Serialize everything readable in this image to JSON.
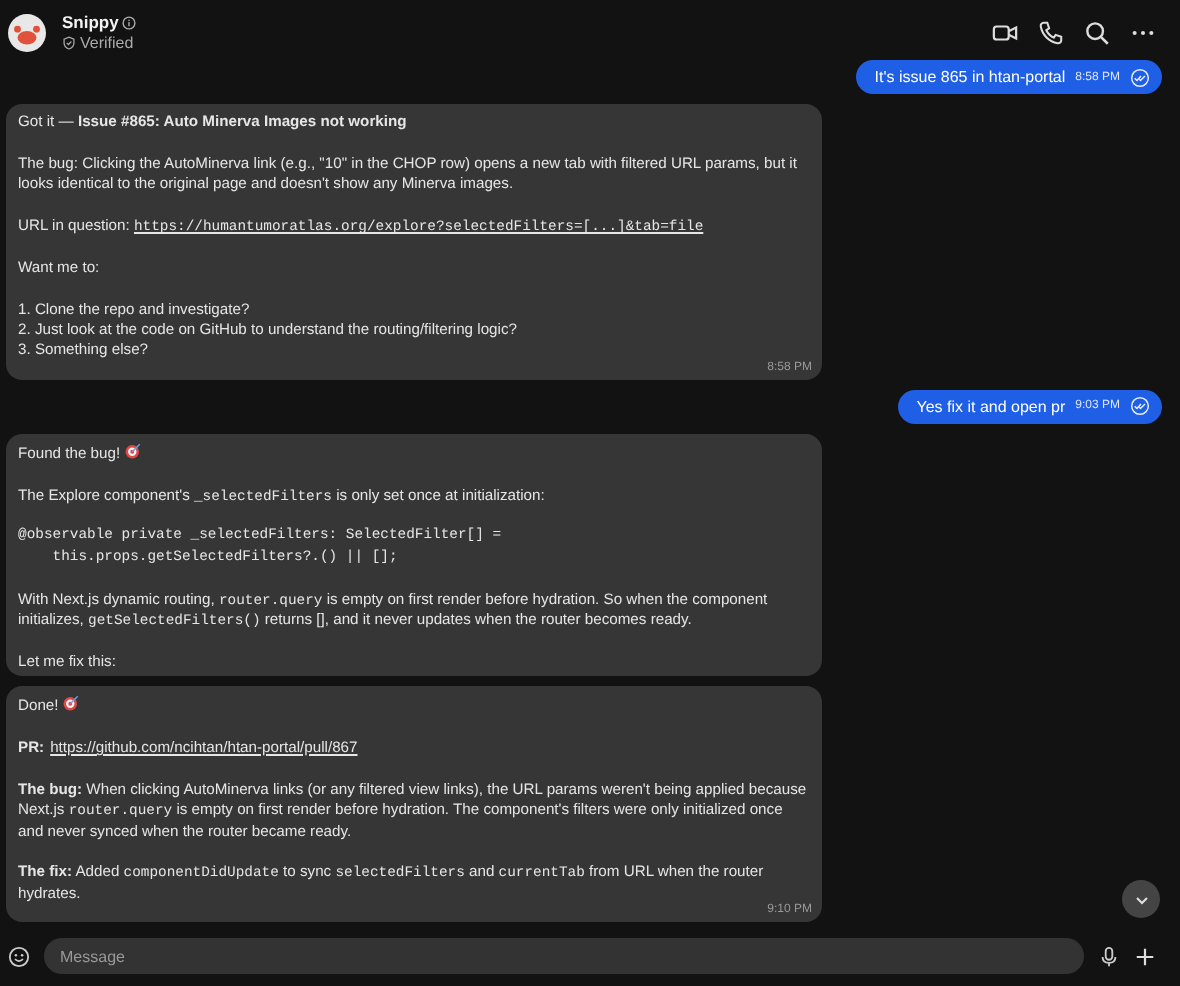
{
  "header": {
    "name": "Snippy",
    "status": "Verified"
  },
  "messages": [
    {
      "kind": "outgoing",
      "text": "It's issue 865 in htan-portal",
      "time": "8:58 PM"
    },
    {
      "kind": "incoming",
      "time": "8:58 PM",
      "paragraphs": [
        {
          "kind": "text",
          "segments": [
            {
              "kind": "plain",
              "text": "Got it — "
            },
            {
              "kind": "bold",
              "text": "Issue #865: Auto Minerva Images not working"
            }
          ]
        },
        {
          "kind": "text",
          "segments": [
            {
              "kind": "plain",
              "text": "The bug: Clicking the AutoMinerva link (e.g., \"10\" in the CHOP row) opens a new tab with filtered URL params, but it looks identical to the original page and doesn't show any Minerva images."
            }
          ]
        },
        {
          "kind": "text",
          "segments": [
            {
              "kind": "plain",
              "text": "URL in question: "
            },
            {
              "kind": "code_link",
              "text": "https://humantumoratlas.org/explore?selectedFilters=[...]&tab=file"
            }
          ]
        },
        {
          "kind": "text",
          "segments": [
            {
              "kind": "plain",
              "text": "Want me to:"
            }
          ]
        },
        {
          "kind": "list",
          "items": [
            "1. Clone the repo and investigate?",
            "2. Just look at the code on GitHub to understand the routing/filtering logic?",
            "3. Something else?"
          ]
        }
      ]
    },
    {
      "kind": "outgoing",
      "text": "Yes fix it and open pr",
      "time": "9:03 PM"
    },
    {
      "kind": "incoming",
      "paragraphs": [
        {
          "kind": "text",
          "segments": [
            {
              "kind": "plain",
              "text": "Found the bug! "
            },
            {
              "kind": "icon"
            }
          ]
        },
        {
          "kind": "text",
          "segments": [
            {
              "kind": "plain",
              "text": "The Explore component's "
            },
            {
              "kind": "code",
              "text": "_selectedFilters"
            },
            {
              "kind": "plain",
              "text": " is only set once at initialization:"
            }
          ]
        },
        {
          "kind": "code",
          "lines": [
            "@observable private _selectedFilters: SelectedFilter[] =",
            "    this.props.getSelectedFilters?.() || [];"
          ]
        },
        {
          "kind": "text",
          "segments": [
            {
              "kind": "plain",
              "text": "With Next.js dynamic routing, "
            },
            {
              "kind": "code",
              "text": "router.query"
            },
            {
              "kind": "plain",
              "text": " is empty on first render before hydration. So when the component initializes, "
            },
            {
              "kind": "code",
              "text": "getSelectedFilters()"
            },
            {
              "kind": "plain",
              "text": " returns [], and it never updates when the router becomes ready."
            }
          ]
        },
        {
          "kind": "text",
          "segments": [
            {
              "kind": "plain",
              "text": "Let me fix this:"
            }
          ]
        }
      ]
    },
    {
      "kind": "incoming",
      "time": "9:10 PM",
      "paragraphs": [
        {
          "kind": "text",
          "segments": [
            {
              "kind": "plain",
              "text": "Done! "
            },
            {
              "kind": "icon"
            }
          ]
        },
        {
          "kind": "text",
          "segments": [
            {
              "kind": "bold",
              "text": "PR:"
            },
            {
              "kind": "link",
              "text": "https://github.com/ncihtan/htan-portal/pull/867"
            }
          ]
        },
        {
          "kind": "text",
          "segments": [
            {
              "kind": "bold",
              "text": "The bug:"
            },
            {
              "kind": "plain",
              "text": " When clicking AutoMinerva links (or any filtered view links), the URL params weren't being applied because Next.js "
            },
            {
              "kind": "code",
              "text": "router.query"
            },
            {
              "kind": "plain",
              "text": " is empty on first render before hydration. The component's filters were only initialized once and never synced when the router became ready."
            }
          ]
        },
        {
          "kind": "text",
          "segments": [
            {
              "kind": "bold",
              "text": "The fix:"
            },
            {
              "kind": "plain",
              "text": " Added "
            },
            {
              "kind": "code",
              "text": "componentDidUpdate"
            },
            {
              "kind": "plain",
              "text": " to sync "
            },
            {
              "kind": "code",
              "text": "selectedFilters"
            },
            {
              "kind": "plain",
              "text": " and "
            },
            {
              "kind": "code",
              "text": "currentTab"
            },
            {
              "kind": "plain",
              "text": " from URL when the router hydrates."
            }
          ]
        }
      ]
    }
  ],
  "composer": {
    "placeholder": "Message"
  }
}
